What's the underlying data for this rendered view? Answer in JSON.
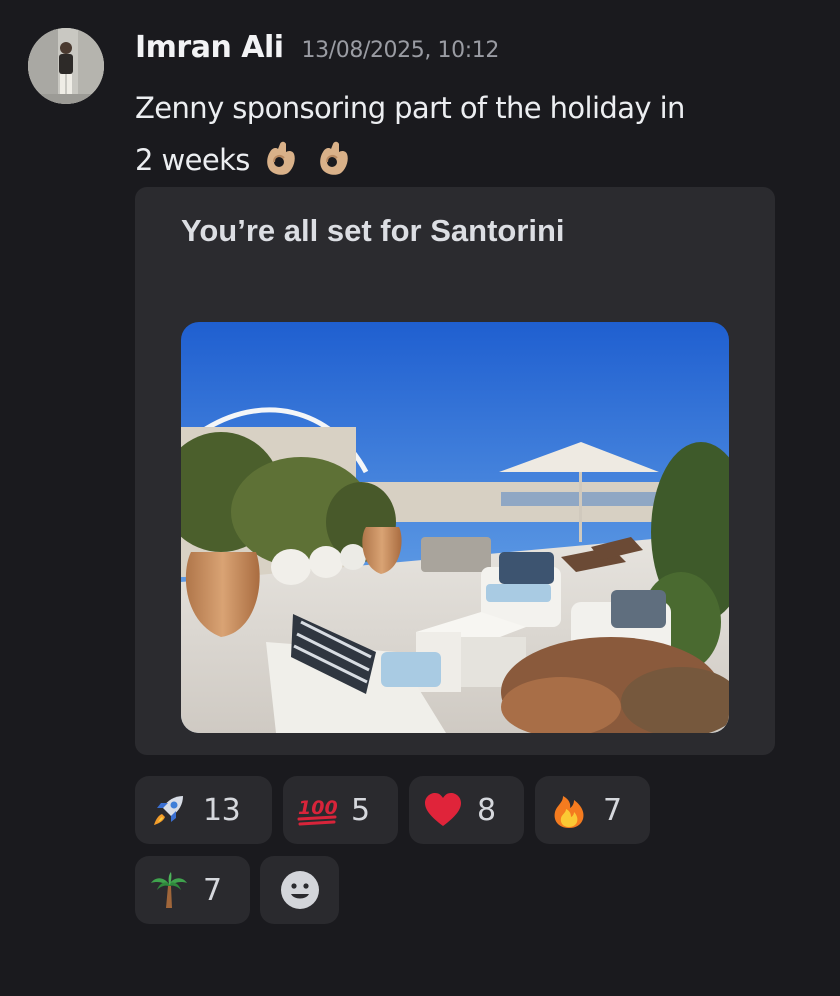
{
  "message": {
    "author": "Imran Ali",
    "timestamp": "13/08/2025, 10:12",
    "text_line1": "Zenny sponsoring part of the holiday in",
    "text_line2": "2 weeks",
    "trailing_emoji": [
      "ok-hand-emoji",
      "ok-hand-emoji"
    ]
  },
  "embed": {
    "title": "You’re all set for Santorini",
    "image": "santorini-terrace-photo"
  },
  "reactions": [
    {
      "emoji": "rocket-emoji",
      "count": "13"
    },
    {
      "emoji": "hundred-points-emoji",
      "count": "5"
    },
    {
      "emoji": "red-heart-emoji",
      "count": "8"
    },
    {
      "emoji": "fire-emoji",
      "count": "7"
    },
    {
      "emoji": "palm-tree-emoji",
      "count": "7"
    }
  ],
  "add_reaction": {
    "icon": "add-reaction-icon"
  },
  "colors": {
    "background": "#1a1a1e",
    "embed_background": "#2b2b2f",
    "reaction_background": "#2a2a2e",
    "timestamp": "#9a9ca3"
  }
}
